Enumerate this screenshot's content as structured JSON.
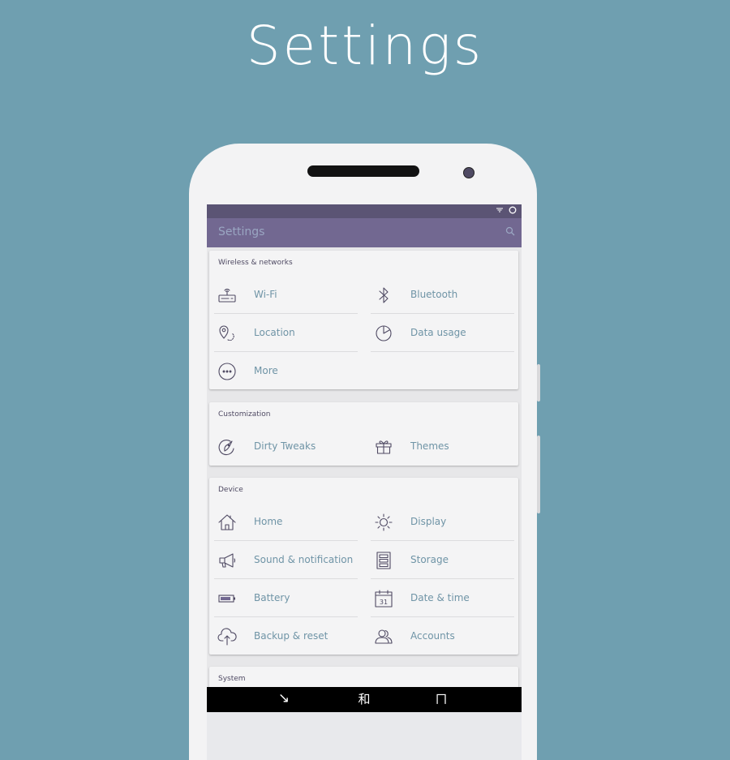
{
  "heading": "Settings",
  "app_bar": {
    "title": "Settings"
  },
  "sections": {
    "wireless": {
      "title": "Wireless & networks",
      "items": [
        "Wi-Fi",
        "Bluetooth",
        "Location",
        "Data usage",
        "More"
      ]
    },
    "customization": {
      "title": "Customization",
      "items": [
        "Dirty Tweaks",
        "Themes"
      ]
    },
    "device": {
      "title": "Device",
      "items": [
        "Home",
        "Display",
        "Sound & notification",
        "Storage",
        "Battery",
        "Date & time",
        "Backup & reset",
        "Accounts"
      ]
    },
    "system": {
      "title": "System"
    }
  },
  "calendar_day": "31",
  "nav_glyphs": {
    "back": "↘",
    "home": "和",
    "recents": "ㄇ"
  },
  "colors": {
    "background": "#6f9fb0",
    "status_bar": "#5b5474",
    "app_bar": "#726891",
    "label": "#6f94a6",
    "icon": "#4f4a63"
  },
  "icons": [
    "wifi-router-icon",
    "bluetooth-icon",
    "location-icon",
    "data-usage-icon",
    "more-icon",
    "dirty-tweaks-icon",
    "themes-gift-icon",
    "home-icon",
    "display-sun-icon",
    "sound-megaphone-icon",
    "storage-icon",
    "battery-icon",
    "calendar-icon",
    "backup-cloud-icon",
    "accounts-icon",
    "search-icon",
    "wifi-status-icon",
    "signal-ring-icon"
  ]
}
